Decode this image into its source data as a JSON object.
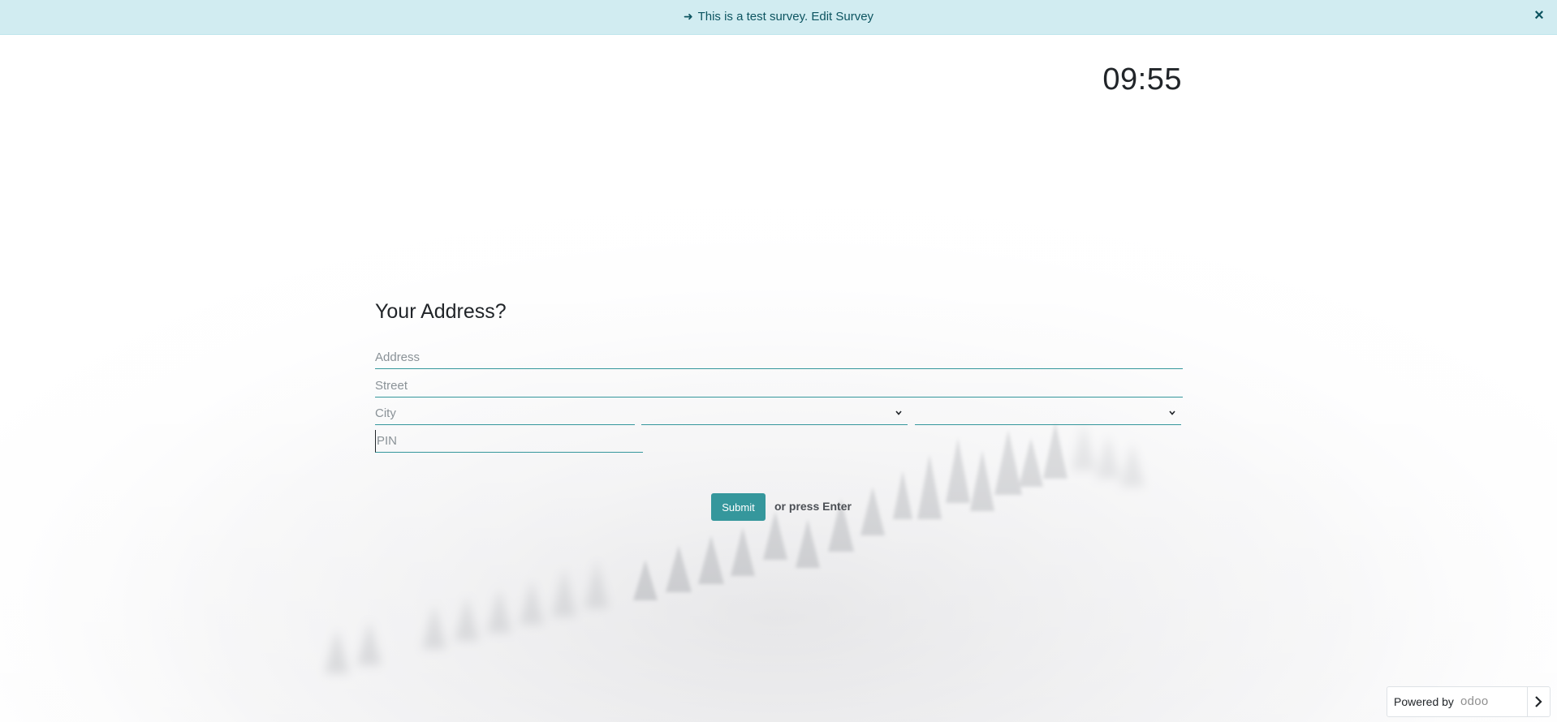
{
  "banner": {
    "text": "This is a test survey.",
    "link": "Edit Survey",
    "arrow_icon": "arrow-right-icon",
    "close_icon": "close-icon"
  },
  "timer": {
    "value": "09:55"
  },
  "question": {
    "title": "Your Address?",
    "fields": {
      "address_placeholder": "Address",
      "street_placeholder": "Street",
      "city_placeholder": "City",
      "state_value": "",
      "country_value": "",
      "pin_placeholder": "PIN"
    }
  },
  "actions": {
    "submit_label": "Submit",
    "hint": "or press Enter"
  },
  "footer": {
    "powered_label": "Powered by",
    "brand": "odoo",
    "next_icon": "chevron-right-icon"
  },
  "colors": {
    "accent": "#35979c",
    "banner_bg": "#d1ecf1",
    "banner_text": "#0c5460"
  }
}
